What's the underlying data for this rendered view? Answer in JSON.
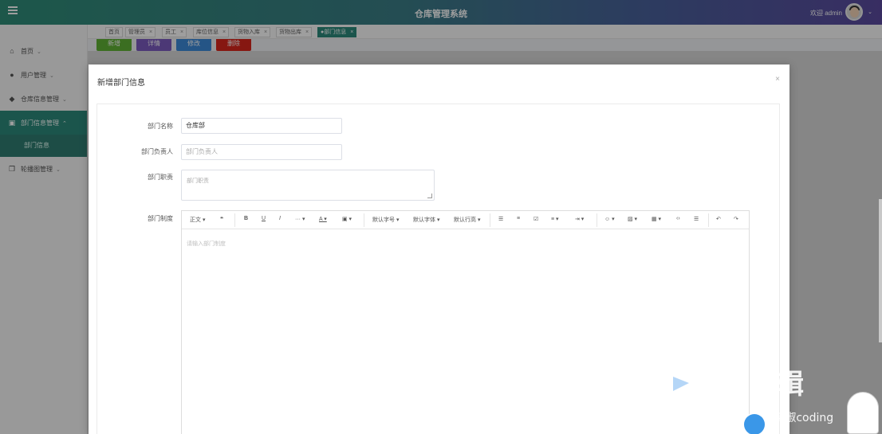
{
  "header": {
    "title": "仓库管理系统",
    "welcome": "欢迎 admin"
  },
  "sidebar": {
    "items": [
      {
        "label": "首页",
        "icon": "home-icon"
      },
      {
        "label": "用户管理",
        "icon": "user-icon"
      },
      {
        "label": "仓库信息管理",
        "icon": "warehouse-icon"
      },
      {
        "label": "部门信息管理",
        "icon": "department-icon"
      },
      {
        "label": "轮播图管理",
        "icon": "carousel-icon"
      }
    ],
    "subitem": "部门信息"
  },
  "tabs": [
    {
      "label": "首页",
      "closable": false
    },
    {
      "label": "管理员",
      "closable": true
    },
    {
      "label": "员工",
      "closable": true
    },
    {
      "label": "库位信息",
      "closable": true
    },
    {
      "label": "货物入库",
      "closable": true
    },
    {
      "label": "货物出库",
      "closable": true
    },
    {
      "label": "●部门信息",
      "closable": true,
      "active": true
    }
  ],
  "actions": {
    "add": "新增",
    "detail": "详情",
    "edit": "修改",
    "delete": "删除"
  },
  "modal": {
    "title": "新增部门信息",
    "fields": {
      "name": {
        "label": "部门名称",
        "value": "仓库部"
      },
      "manager": {
        "label": "部门负责人",
        "placeholder": "部门负责人"
      },
      "duty": {
        "label": "部门职责",
        "placeholder": "部门职责"
      },
      "system": {
        "label": "部门制度"
      }
    },
    "editor": {
      "placeholder": "请输入部门制度",
      "toolbar": {
        "heading": "正文",
        "font_size": "默认字号",
        "font_family": "默认字体",
        "line_height": "默认行高"
      }
    }
  },
  "watermark": {
    "text": "剪辑",
    "csdn": "CSDN @花椒coding"
  },
  "colors": {
    "accent": "#2c8a7b",
    "add": "#5fb236",
    "detail": "#7b5bbf",
    "edit": "#3d8ad8",
    "delete": "#d9261c"
  }
}
